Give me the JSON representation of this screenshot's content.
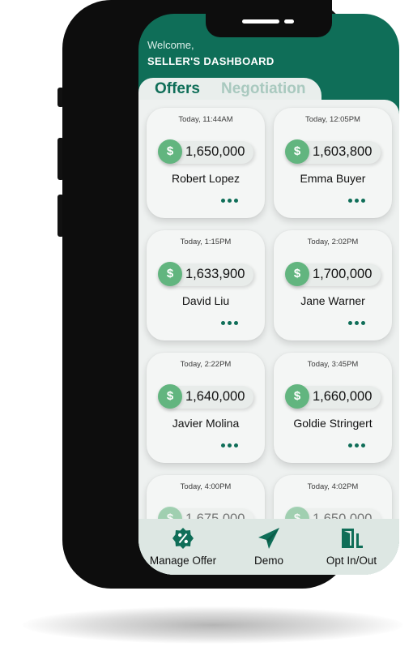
{
  "header": {
    "welcome": "Welcome,",
    "title": "SELLER'S DASHBOARD"
  },
  "tabs": [
    {
      "label": "Offers",
      "active": true
    },
    {
      "label": "Negotiation",
      "active": false
    }
  ],
  "offers": [
    {
      "time": "Today, 11:44AM",
      "amount": "1,650,000",
      "name": "Robert Lopez"
    },
    {
      "time": "Today, 12:05PM",
      "amount": "1,603,800",
      "name": "Emma Buyer"
    },
    {
      "time": "Today, 1:15PM",
      "amount": "1,633,900",
      "name": "David Liu"
    },
    {
      "time": "Today, 2:02PM",
      "amount": "1,700,000",
      "name": "Jane Warner"
    },
    {
      "time": "Today, 2:22PM",
      "amount": "1,640,000",
      "name": "Javier Molina"
    },
    {
      "time": "Today, 3:45PM",
      "amount": "1,660,000",
      "name": "Goldie Stringert"
    },
    {
      "time": "Today, 4:00PM",
      "amount": "1,675,000",
      "name": ""
    },
    {
      "time": "Today, 4:02PM",
      "amount": "1,650,000",
      "name": ""
    }
  ],
  "currency_symbol": "$",
  "bottom_nav": [
    {
      "label": "Manage Offer",
      "icon": "percent-badge-icon"
    },
    {
      "label": "Demo",
      "icon": "paper-plane-icon"
    },
    {
      "label": "Opt In/Out",
      "icon": "door-exit-icon"
    }
  ],
  "colors": {
    "brand_green": "#0f6e58",
    "dollar_green": "#62b57f",
    "inactive_tab": "#a9c9bf"
  }
}
